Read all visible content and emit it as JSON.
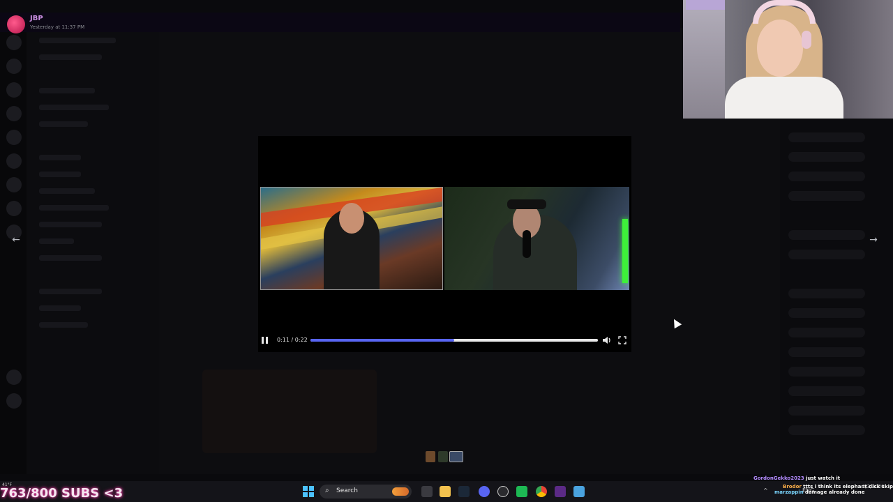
{
  "message": {
    "author": "JBP",
    "timestamp": "Yesterday at 11:37 PM"
  },
  "player": {
    "time": "0:11 / 0:22",
    "progress_fraction": 0.5,
    "pause_icon": "pause-icon",
    "volume_icon": "volume-icon",
    "fullscreen_icon": "fullscreen-icon",
    "accent_color": "#5865f2"
  },
  "nav": {
    "prev_glyph": "←",
    "next_glyph": "→"
  },
  "overlay": {
    "subs_goal": "763/800 SUBS <3",
    "weather": "41°F"
  },
  "chat": [
    {
      "user": "GordonGekko2023",
      "user_color": "#b48cff",
      "message": "just watch it"
    },
    {
      "user": "Brodor",
      "user_color": "#ffb04a",
      "message": "ttts i think its elephant dick skip"
    },
    {
      "user": "marzappin",
      "user_color": "#7ad6ff",
      "message": "damage already done"
    }
  ],
  "taskbar": {
    "search_label": "Search",
    "search_glyph": "⌕",
    "tray_up": "^",
    "language": "ENG",
    "clock_date": "2/3/2026",
    "app_icons": [
      "windows-start-icon",
      "search-icon",
      "task-view-icon",
      "file-explorer-icon",
      "steam-icon",
      "discord-icon",
      "obs-icon",
      "spotify-icon",
      "chrome-icon",
      "app-icon",
      "notepad-icon"
    ]
  }
}
